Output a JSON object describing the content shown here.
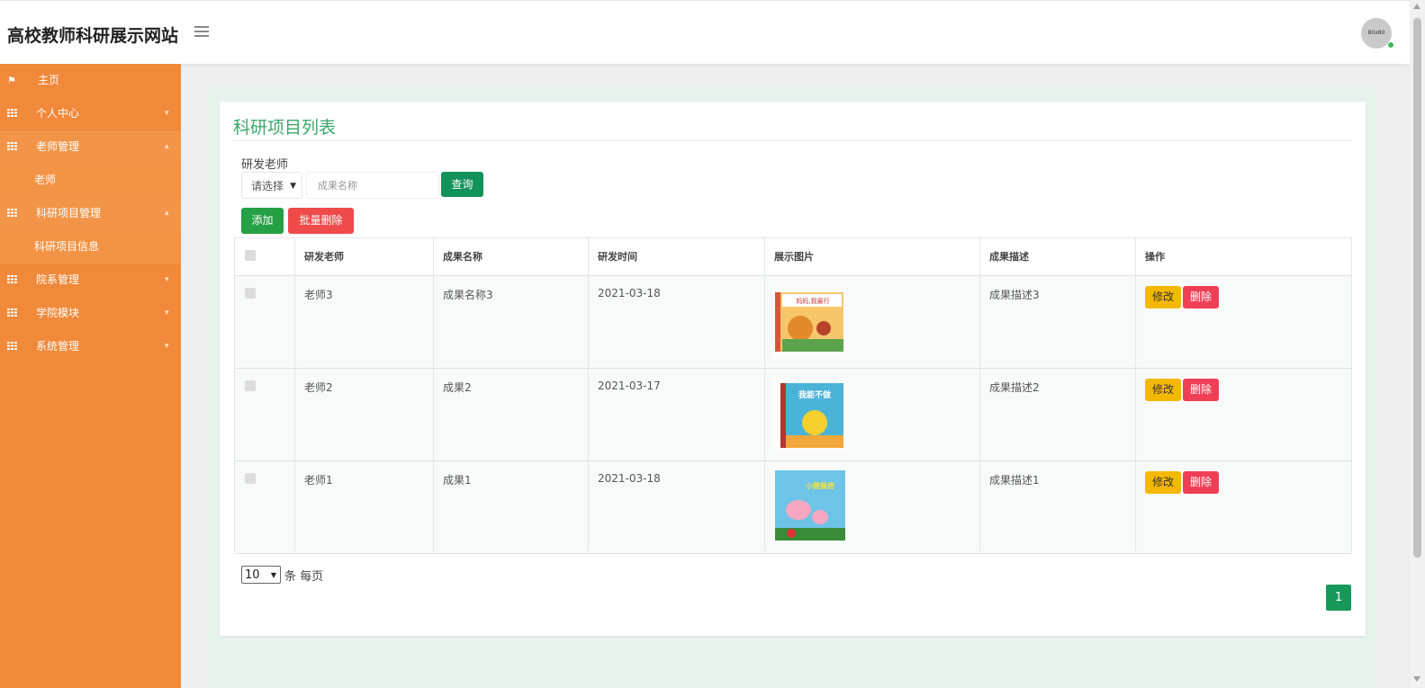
{
  "app": {
    "title": "高校教师科研展示网站",
    "avatar_text": "80x80"
  },
  "sidebar": {
    "items": [
      {
        "label": "主页"
      },
      {
        "label": "个人中心"
      },
      {
        "label": "老师管理"
      },
      {
        "label": "老师"
      },
      {
        "label": "科研项目管理"
      },
      {
        "label": "科研项目信息"
      },
      {
        "label": "院系管理"
      },
      {
        "label": "学院模块"
      },
      {
        "label": "系统管理"
      }
    ]
  },
  "panel": {
    "title": "科研项目列表",
    "filter_label": "研发老师",
    "select_value": "请选择",
    "search_placeholder": "成果名称",
    "search_button": "查询",
    "add_button": "添加",
    "bulk_delete_button": "批量删除"
  },
  "table": {
    "headers": [
      "研发老师",
      "成果名称",
      "研发时间",
      "展示图片",
      "成果描述",
      "操作"
    ],
    "rows": [
      {
        "teacher": "老师3",
        "name": "成果名称3",
        "date": "2021-03-18",
        "desc": "成果描述3",
        "edit": "修改",
        "delete": "删除"
      },
      {
        "teacher": "老师2",
        "name": "成果2",
        "date": "2021-03-17",
        "desc": "成果描述2",
        "edit": "修改",
        "delete": "删除"
      },
      {
        "teacher": "老师1",
        "name": "成果1",
        "date": "2021-03-18",
        "desc": "成果描述1",
        "edit": "修改",
        "delete": "删除"
      }
    ],
    "thumb_texts": [
      "妈妈,我最行",
      "我能不做",
      "小猪佩奇"
    ]
  },
  "pagination": {
    "page_size": "10",
    "page_size_label": "条 每页",
    "current_page": "1"
  },
  "colors": {
    "sidebar": "#f0893a",
    "accent": "#3aa86b",
    "danger": "#ef3f55",
    "warning": "#f5b800"
  }
}
